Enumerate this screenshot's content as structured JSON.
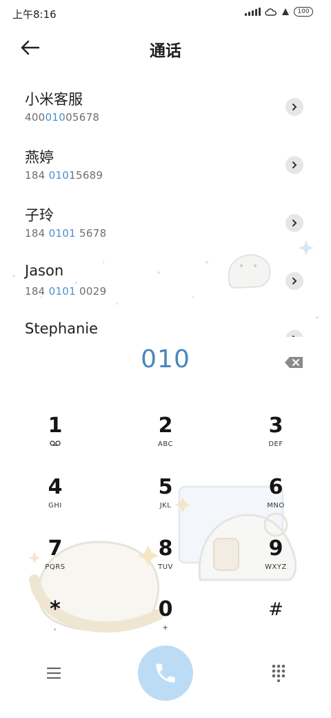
{
  "status_bar": {
    "time": "上午8:16",
    "battery": "100"
  },
  "header": {
    "title": "通话"
  },
  "contacts": [
    {
      "name": "小米客服",
      "num_pre": "400",
      "num_hl": "010",
      "num_post": "05678"
    },
    {
      "name": "燕婷",
      "num_pre": "184 ",
      "num_hl": "010",
      "num_post": "15689"
    },
    {
      "name": "子玲",
      "num_pre": "184 ",
      "num_hl": "0101",
      "num_post": " 5678"
    },
    {
      "name": "Jason",
      "num_pre": "184 ",
      "num_hl": "0101",
      "num_post": " 0029"
    },
    {
      "name": "Stephanie",
      "num_pre": "",
      "num_hl": "",
      "num_post": ""
    }
  ],
  "dialer": {
    "input": "010"
  },
  "keypad": [
    {
      "digit": "1",
      "sub": ""
    },
    {
      "digit": "2",
      "sub": "ABC"
    },
    {
      "digit": "3",
      "sub": "DEF"
    },
    {
      "digit": "4",
      "sub": "GHI"
    },
    {
      "digit": "5",
      "sub": "JKL"
    },
    {
      "digit": "6",
      "sub": "MNO"
    },
    {
      "digit": "7",
      "sub": "PQRS"
    },
    {
      "digit": "8",
      "sub": "TUV"
    },
    {
      "digit": "9",
      "sub": "WXYZ"
    },
    {
      "digit": "*",
      "sub": ","
    },
    {
      "digit": "0",
      "sub": "+"
    },
    {
      "digit": "#",
      "sub": ""
    }
  ],
  "colors": {
    "accent": "#4a86bf",
    "highlight": "#4a8fd1",
    "call_button": "#bcdcf5"
  },
  "icons": {
    "back": "arrow-left-icon",
    "delete": "backspace-icon",
    "menu": "menu-icon",
    "call": "phone-icon",
    "dialpad": "dialpad-icon",
    "voicemail": "voicemail-icon"
  }
}
